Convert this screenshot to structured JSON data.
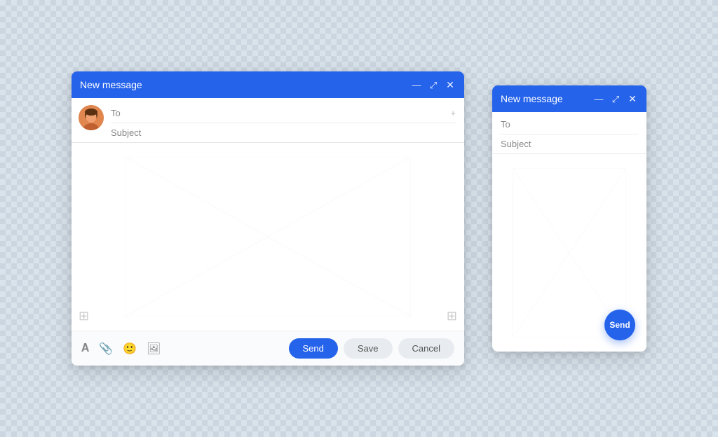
{
  "background": {
    "color": "#d4dfe8"
  },
  "large_window": {
    "title": "New message",
    "fields": {
      "to_label": "To",
      "subject_label": "Subject"
    },
    "footer_icons": [
      "font-icon",
      "attachment-icon",
      "emoji-icon",
      "image-icon"
    ],
    "buttons": {
      "send": "Send",
      "save": "Save",
      "cancel": "Cancel"
    },
    "controls": {
      "minimize": "—",
      "maximize": "⤢",
      "close": "✕"
    }
  },
  "small_window": {
    "title": "New message",
    "fields": {
      "to_label": "To",
      "subject_label": "Subject"
    },
    "fab_label": "Send",
    "controls": {
      "minimize": "—",
      "maximize": "⤢",
      "close": "✕"
    }
  }
}
